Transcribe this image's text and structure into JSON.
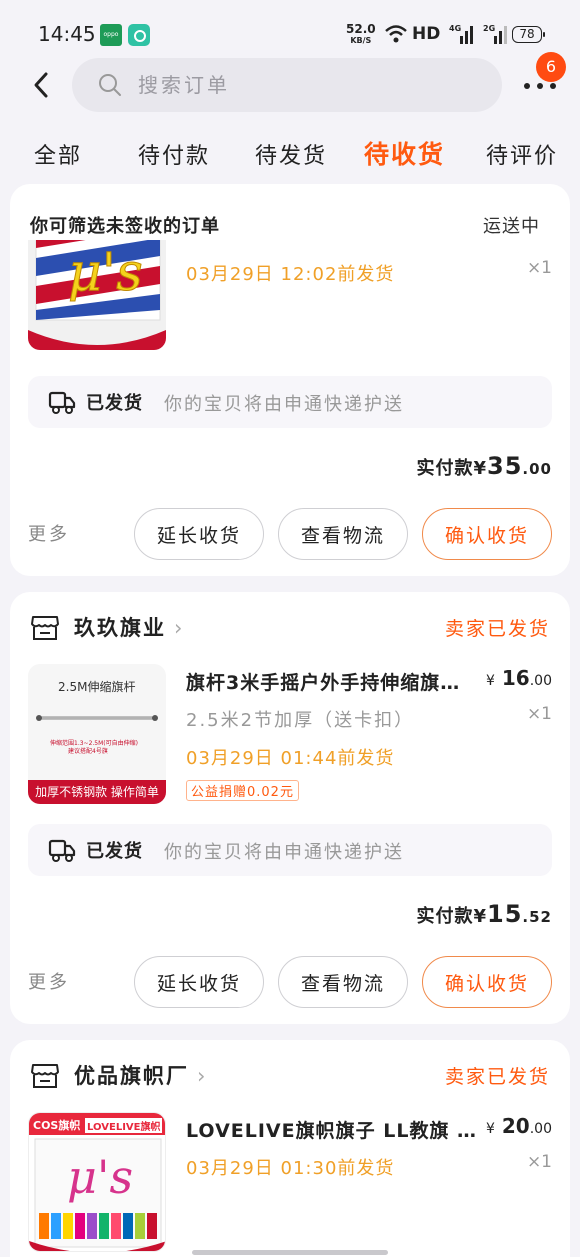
{
  "status_bar": {
    "time": "14:45",
    "app1_label": "oppo",
    "net_speed": "52.0",
    "net_unit": "KB/S",
    "hd": "HD",
    "sig1": "4G",
    "sig2": "2G",
    "battery": "78"
  },
  "header": {
    "search_placeholder": "搜索订单",
    "badge": "6"
  },
  "tabs": [
    {
      "label": "全部",
      "active": false
    },
    {
      "label": "待付款",
      "active": false
    },
    {
      "label": "待发货",
      "active": false
    },
    {
      "label": "待收货",
      "active": true
    },
    {
      "label": "待评价",
      "active": false
    }
  ],
  "filter": {
    "label": "你可筛选未签收的订单",
    "status": "运送中"
  },
  "orders": [
    {
      "item": {
        "ship_by": "03月29日  12:02前发货",
        "qty": "×1"
      },
      "shipping": {
        "title": "已发货",
        "desc": "你的宝贝将由申通快递护送"
      },
      "paid": {
        "label": "实付款",
        "currency": "¥",
        "int": "35",
        "dec": ".00"
      },
      "actions": {
        "more": "更多",
        "extend": "延长收货",
        "logistics": "查看物流",
        "confirm": "确认收货"
      }
    },
    {
      "shop": {
        "name": "玖玖旗业",
        "status": "卖家已发货"
      },
      "item": {
        "thumb_label": "2.5M伸缩旗杆",
        "thumb_note": "伸缩范围1.3~2.5M(可自由伸缩)",
        "thumb_note2": "建议搭配4号旗",
        "thumb_banner": "加厚不锈钢款 操作简单",
        "title": "旗杆3米手摇户外手持伸缩旗…",
        "price_currency": "¥",
        "price_int": "16",
        "price_dec": ".00",
        "spec": "2.5米2节加厚（送卡扣）",
        "qty": "×1",
        "ship_by": "03月29日  01:44前发货",
        "tag": "公益捐赠0.02元"
      },
      "shipping": {
        "title": "已发货",
        "desc": "你的宝贝将由申通快递护送"
      },
      "paid": {
        "label": "实付款",
        "currency": "¥",
        "int": "15",
        "dec": ".52"
      },
      "actions": {
        "more": "更多",
        "extend": "延长收货",
        "logistics": "查看物流",
        "confirm": "确认收货"
      }
    },
    {
      "shop": {
        "name": "优品旗帜厂",
        "status": "卖家已发货"
      },
      "item": {
        "thumb_tag1": "COS旗帜",
        "thumb_tag2": "LOVELIVE旗帜",
        "title": "LOVELIVE旗帜旗子 LL教旗 …",
        "price_currency": "¥",
        "price_int": "20",
        "price_dec": ".00",
        "qty": "×1",
        "ship_by": "03月29日  01:30前发货"
      }
    }
  ],
  "colors": {
    "accent": "#ff5a10",
    "ship_date": "#f0a028",
    "background": "#f4f3f8"
  }
}
